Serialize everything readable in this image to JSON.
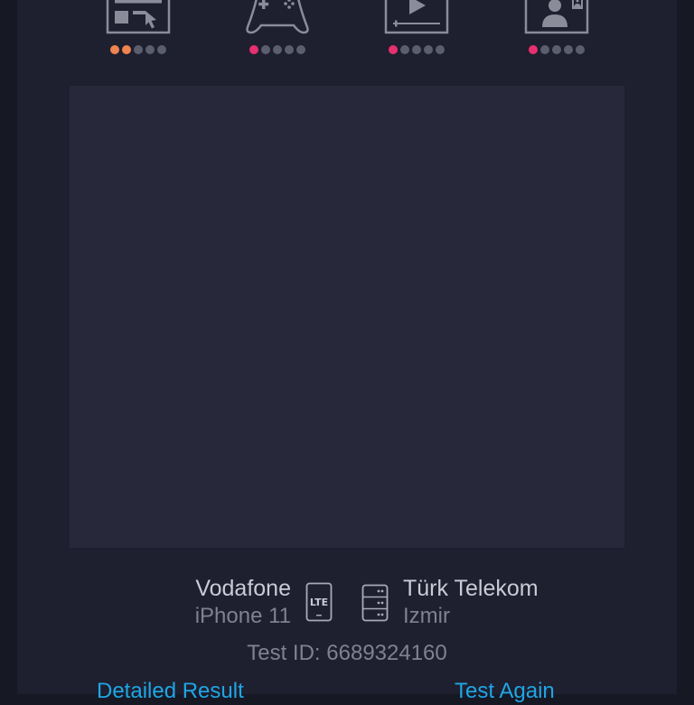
{
  "ratings": [
    {
      "icon": "web-browsing-icon",
      "filled": 2,
      "total": 5,
      "color": "#f0844f"
    },
    {
      "icon": "gamepad-icon",
      "filled": 1,
      "total": 5,
      "color": "#e82f6f"
    },
    {
      "icon": "video-play-icon",
      "filled": 1,
      "total": 5,
      "color": "#e82f6f"
    },
    {
      "icon": "video-call-icon",
      "filled": 1,
      "total": 5,
      "color": "#e82f6f"
    }
  ],
  "device": {
    "carrier": "Vodafone",
    "model": "iPhone 11",
    "network_badge": "LTE"
  },
  "server": {
    "provider": "Türk Telekom",
    "location": "Izmir"
  },
  "test_id": "Test ID: 6689324160",
  "actions": {
    "detailed": "Detailed Result",
    "again": "Test Again"
  },
  "colors": {
    "link": "#1fa6e5",
    "background": "#1e1f2f"
  }
}
